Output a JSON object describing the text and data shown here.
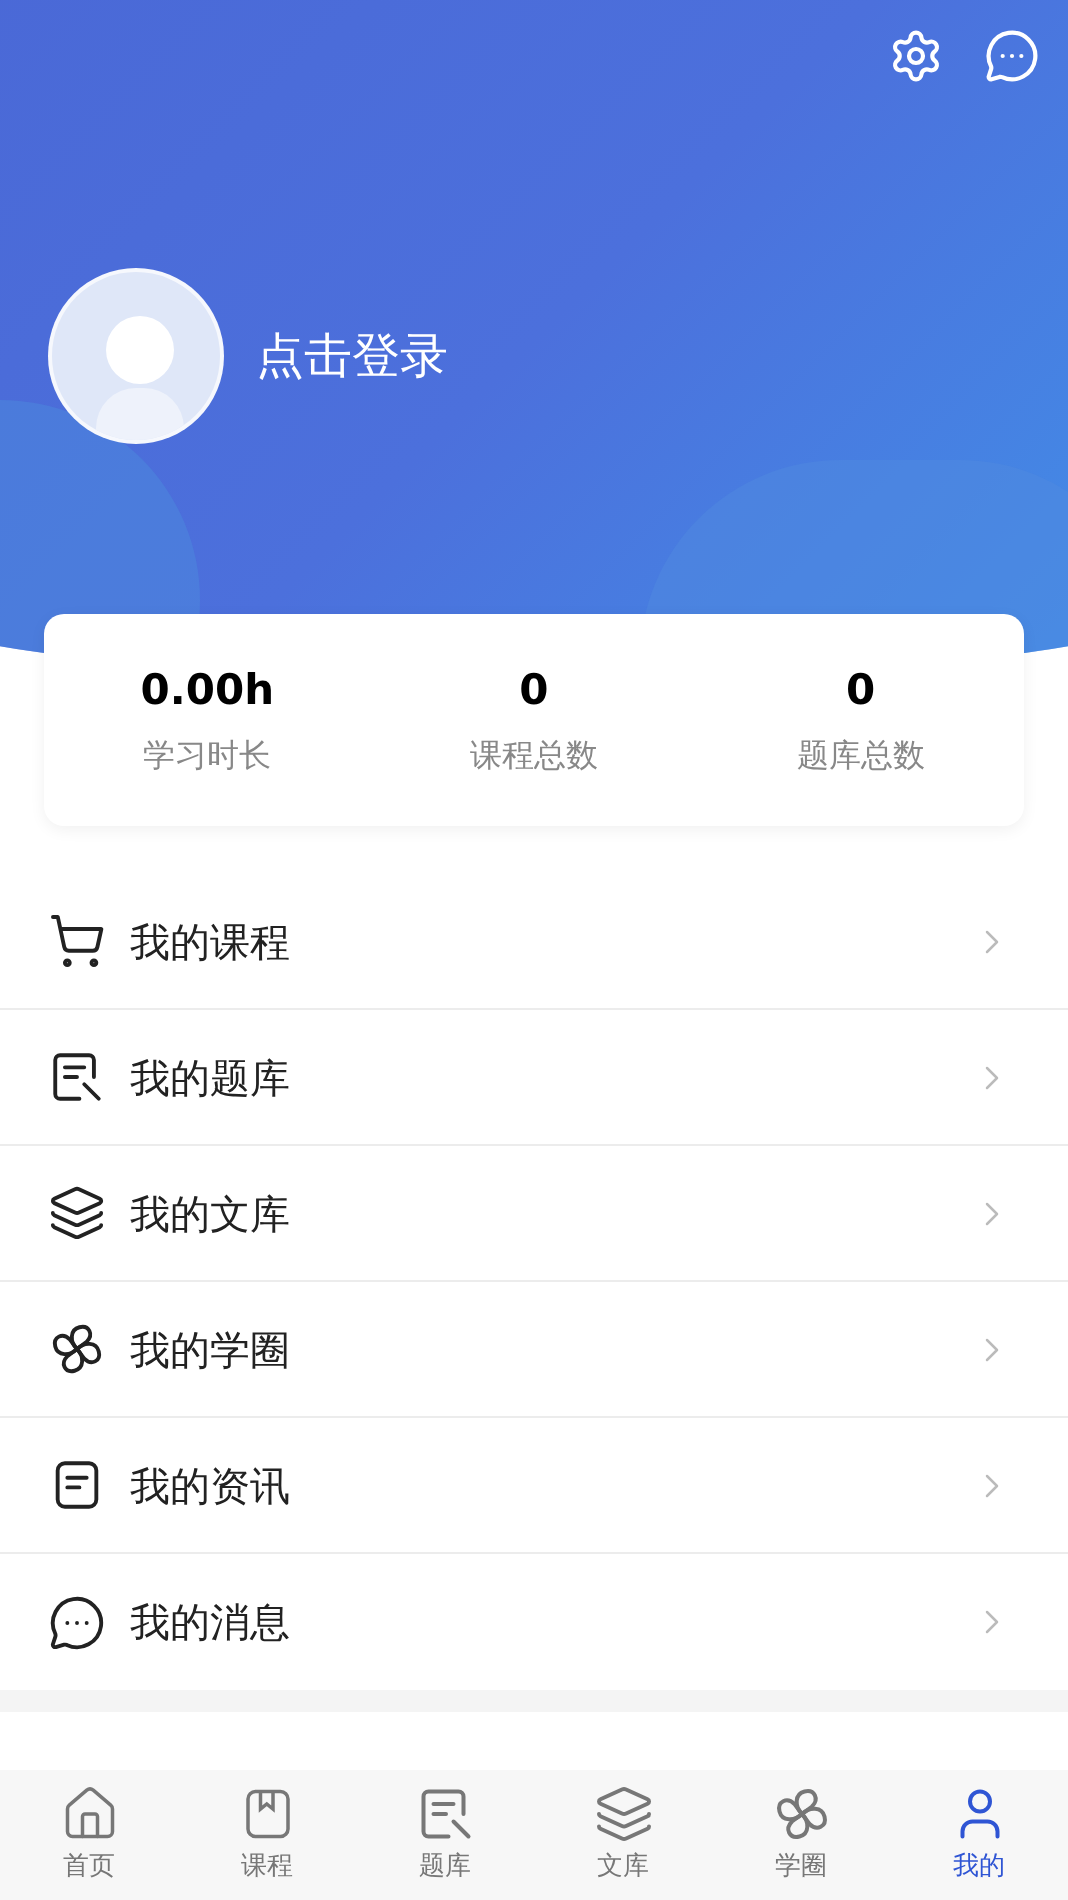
{
  "header": {
    "login_text": "点击登录"
  },
  "stats": [
    {
      "value": "0.00h",
      "label": "学习时长"
    },
    {
      "value": "0",
      "label": "课程总数"
    },
    {
      "value": "0",
      "label": "题库总数"
    }
  ],
  "menu": [
    {
      "kind": "cart",
      "label": "我的课程"
    },
    {
      "kind": "quiz",
      "label": "我的题库"
    },
    {
      "kind": "layers",
      "label": "我的文库"
    },
    {
      "kind": "clover",
      "label": "我的学圈"
    },
    {
      "kind": "news",
      "label": "我的资讯"
    },
    {
      "kind": "chat",
      "label": "我的消息"
    }
  ],
  "tab_bar": [
    {
      "kind": "home",
      "label": "首页",
      "selected": false
    },
    {
      "kind": "book",
      "label": "课程",
      "selected": false
    },
    {
      "kind": "quiz",
      "label": "题库",
      "selected": false
    },
    {
      "kind": "layers",
      "label": "文库",
      "selected": false
    },
    {
      "kind": "clover",
      "label": "学圈",
      "selected": false
    },
    {
      "kind": "user",
      "label": "我的",
      "selected": true
    }
  ]
}
